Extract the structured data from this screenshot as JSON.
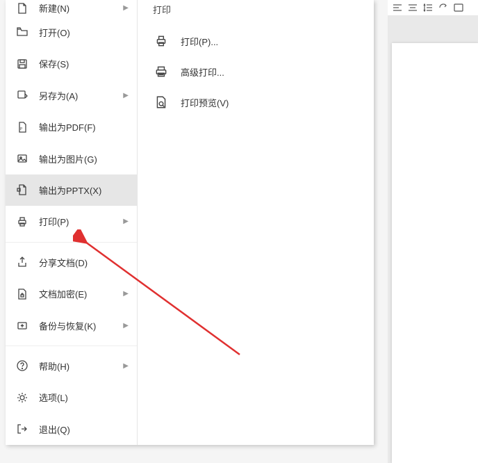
{
  "leftMenu": {
    "items": [
      {
        "label": "新建(N)",
        "hasArrow": true
      },
      {
        "label": "打开(O)",
        "hasArrow": false
      },
      {
        "label": "保存(S)",
        "hasArrow": false
      },
      {
        "label": "另存为(A)",
        "hasArrow": true
      },
      {
        "label": "输出为PDF(F)",
        "hasArrow": false
      },
      {
        "label": "输出为图片(G)",
        "hasArrow": false
      },
      {
        "label": "输出为PPTX(X)",
        "hasArrow": false
      },
      {
        "label": "打印(P)",
        "hasArrow": true
      },
      {
        "label": "分享文档(D)",
        "hasArrow": false
      },
      {
        "label": "文档加密(E)",
        "hasArrow": true
      },
      {
        "label": "备份与恢复(K)",
        "hasArrow": true
      },
      {
        "label": "帮助(H)",
        "hasArrow": true
      },
      {
        "label": "选项(L)",
        "hasArrow": false
      },
      {
        "label": "退出(Q)",
        "hasArrow": false
      }
    ]
  },
  "submenu": {
    "title": "打印",
    "items": [
      {
        "label": "打印(P)..."
      },
      {
        "label": "高级打印..."
      },
      {
        "label": "打印预览(V)"
      }
    ]
  }
}
